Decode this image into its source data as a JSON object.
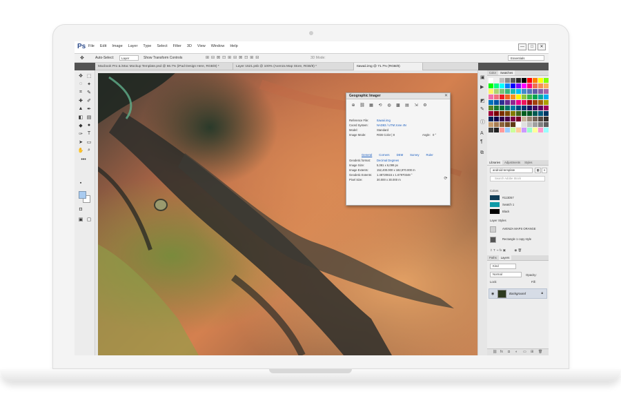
{
  "app": {
    "logo": "Ps",
    "menu": [
      "File",
      "Edit",
      "Image",
      "Layer",
      "Type",
      "Select",
      "Filter",
      "3D",
      "View",
      "Window",
      "Help"
    ],
    "window_controls": [
      "—",
      "□",
      "✕"
    ]
  },
  "options_bar": {
    "auto_select_label": "Auto-Select:",
    "layer_dropdown": "Layer",
    "transform_label": "Show Transform Controls",
    "mode_3d_label": "3D Mode:",
    "workspace": "Essentials"
  },
  "tabs": [
    {
      "label": "Macbook Pro & iMac Mockup Template.psd @ 66.7% (iPad Design Here, RGB/8) *",
      "active": false
    },
    {
      "label": "Layer 1521.psb @ 100% (Avenza Map Store, RGB/8) *",
      "active": false
    },
    {
      "label": "Itawaii.img @ 71.7% (RGB/8)",
      "active": true
    }
  ],
  "geo_panel": {
    "title": "Geographic Imager",
    "close": "✕",
    "icons": [
      "georeference-icon",
      "link-icon",
      "grid-icon",
      "transform-icon",
      "globe-icon",
      "tile-icon",
      "table-icon",
      "export-icon",
      "settings-icon"
    ],
    "fields": [
      {
        "label": "Reference File:",
        "value": "Itawaii.img",
        "link": true
      },
      {
        "label": "Coord System:",
        "value": "NAD83 / UTM zone 4N",
        "link": true
      },
      {
        "label": "Model:",
        "value": "Standard",
        "link": false
      },
      {
        "label": "Image Mode:",
        "value": "RGB Color | 8",
        "link": false
      }
    ],
    "angle_label": "Angle:",
    "angle_value": "0 °",
    "subtabs": [
      "General",
      "Corners",
      "DEM",
      "Survey",
      "Ruler"
    ],
    "geodetic_format_label": "Geodetic format:",
    "geodetic_format_value": "Decimal Degrees",
    "details": [
      {
        "label": "Image Size:",
        "value": "5,081 x 6,099 px"
      },
      {
        "label": "Image Extents:",
        "value": "152,400.000 x 182,970.000 m"
      },
      {
        "label": "Geodetic Extents:",
        "value": "1.48720615 x 1.67970348 °"
      },
      {
        "label": "Pixel Size:",
        "value": "30.000 x 30.000 m"
      }
    ]
  },
  "color_panel": {
    "tabs": [
      "Color",
      "Swatches"
    ],
    "swatches": [
      "#ffffff",
      "#f0f0f0",
      "#bdbdbd",
      "#8c8c8c",
      "#5a5a5a",
      "#2b2b2b",
      "#000000",
      "#ff0000",
      "#ff7f00",
      "#ffff00",
      "#7fff00",
      "#00ff00",
      "#00ff7f",
      "#00ffff",
      "#007fff",
      "#0000ff",
      "#7f00ff",
      "#ff00ff",
      "#ff007f",
      "#f26c4f",
      "#f68e55",
      "#fbaf5c",
      "#fff467",
      "#acd372",
      "#7cc576",
      "#3bb878",
      "#1abbb4",
      "#00bff3",
      "#438ccb",
      "#5574b9",
      "#605ca8",
      "#855fa8",
      "#a763a8",
      "#f06eaa",
      "#f26d7d",
      "#ed1c24",
      "#f26522",
      "#f7941d",
      "#fff200",
      "#8dc63f",
      "#39b54a",
      "#00a651",
      "#00a99d",
      "#00aeef",
      "#0072bc",
      "#0054a6",
      "#2e3192",
      "#662d91",
      "#92278f",
      "#ec008c",
      "#ed145b",
      "#9e0b0f",
      "#a0410d",
      "#a3620a",
      "#aba000",
      "#598527",
      "#1a7b30",
      "#007236",
      "#00746b",
      "#0076a3",
      "#004b80",
      "#003471",
      "#1b1464",
      "#440e62",
      "#630460",
      "#9e005d",
      "#9e0039",
      "#790000",
      "#7b2e00",
      "#7d4900",
      "#827b00",
      "#406618",
      "#005e20",
      "#005826",
      "#005952",
      "#005b7f",
      "#003663",
      "#002157",
      "#0d004c",
      "#32004b",
      "#4b0049",
      "#7b0046",
      "#7a0026",
      "#c7b299",
      "#998675",
      "#736357",
      "#534741",
      "#37302d",
      "#c69c6d",
      "#a67c52",
      "#8c6239",
      "#754c24",
      "#603913",
      "#ffffff",
      "#e0e0e0",
      "#c0c0c0",
      "#a0a0a0",
      "#808080",
      "#606060",
      "#404040",
      "#202020",
      "#ff9999",
      "#99ccff",
      "#ccff99",
      "#ffcc99",
      "#cc99ff",
      "#99ffcc",
      "#ffff99",
      "#ff99cc",
      "#99ffff"
    ]
  },
  "libraries": {
    "tabs": [
      "Libraries",
      "Adjustments",
      "Styles"
    ],
    "library_name": "android-template",
    "search_placeholder": "Search Adobe Stock",
    "colors_header": "Colors",
    "colors": [
      {
        "label": "#113D57",
        "hex": "#113d57"
      },
      {
        "label": "Swatch 1",
        "hex": "#0e9aa7"
      },
      {
        "label": "Black",
        "hex": "#000000"
      }
    ],
    "styles_header": "Layer Styles",
    "styles": [
      "AVENZA MAPS ORANGE",
      "Rectangle 1 copy style"
    ]
  },
  "layers": {
    "tabs": [
      "Paths",
      "Layers"
    ],
    "kind_filter": "Kind",
    "blend_mode": "Normal",
    "opacity_label": "Opacity:",
    "lock_label": "Lock:",
    "fill_label": "Fill:",
    "layer_name": "Background"
  }
}
